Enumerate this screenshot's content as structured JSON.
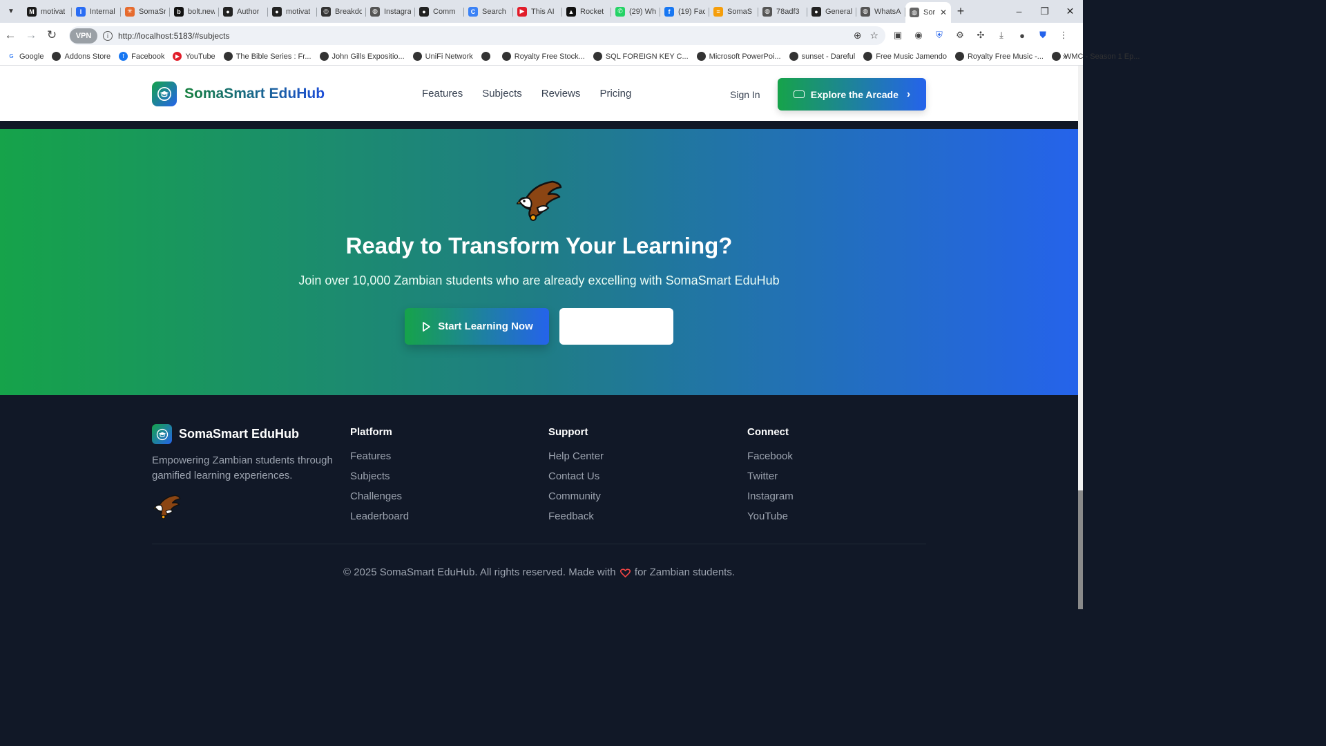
{
  "browser": {
    "tabs": [
      {
        "title": "motivat",
        "color": "#1a1a1a",
        "glyph": "M"
      },
      {
        "title": "Internal",
        "color": "#2a6df4",
        "glyph": "I"
      },
      {
        "title": "SomaSr",
        "color": "#e66b2e",
        "glyph": "✳"
      },
      {
        "title": "bolt.new",
        "color": "#111111",
        "glyph": "b"
      },
      {
        "title": "Author",
        "color": "#222222",
        "glyph": "●"
      },
      {
        "title": "motivat",
        "color": "#222222",
        "glyph": "●"
      },
      {
        "title": "Breakdo",
        "color": "#333333",
        "glyph": "◎"
      },
      {
        "title": "Instagra",
        "color": "#555555",
        "glyph": "◍"
      },
      {
        "title": "Comm",
        "color": "#222222",
        "glyph": "●"
      },
      {
        "title": "Search",
        "color": "#3b82f6",
        "glyph": "C"
      },
      {
        "title": "This AI",
        "color": "#e11d2a",
        "glyph": "▶"
      },
      {
        "title": "Rocket",
        "color": "#111111",
        "glyph": "▲"
      },
      {
        "title": "(29) Wh",
        "color": "#25d366",
        "glyph": "✆"
      },
      {
        "title": "(19) Fac",
        "color": "#1877f2",
        "glyph": "f"
      },
      {
        "title": "SomaS",
        "color": "#f59e0b",
        "glyph": "≡"
      },
      {
        "title": "78adf3",
        "color": "#555555",
        "glyph": "◍"
      },
      {
        "title": "General",
        "color": "#222222",
        "glyph": "●"
      },
      {
        "title": "WhatsA",
        "color": "#555555",
        "glyph": "◍"
      }
    ],
    "active_tab": {
      "title": "Sor",
      "glyph": "◍"
    },
    "new_tab": "+",
    "window_controls": [
      "–",
      "❐",
      "✕"
    ],
    "vpn_label": "VPN",
    "url": "http://localhost:5183/#subjects",
    "bookmarks": [
      {
        "label": "Google",
        "color": "#ffffff",
        "glyph": "G"
      },
      {
        "label": "Addons Store",
        "color": "#333333",
        "glyph": ""
      },
      {
        "label": "Facebook",
        "color": "#1877f2",
        "glyph": "f"
      },
      {
        "label": "YouTube",
        "color": "#e11d2a",
        "glyph": "▶"
      },
      {
        "label": "The Bible Series : Fr...",
        "color": "#333333",
        "glyph": ""
      },
      {
        "label": "John Gills Expositio...",
        "color": "#333333",
        "glyph": ""
      },
      {
        "label": "UniFi Network",
        "color": "#333333",
        "glyph": ""
      },
      {
        "label": "",
        "color": "#333333",
        "glyph": ""
      },
      {
        "label": "Royalty Free Stock...",
        "color": "#333333",
        "glyph": ""
      },
      {
        "label": "SQL FOREIGN KEY C...",
        "color": "#333333",
        "glyph": ""
      },
      {
        "label": "Microsoft PowerPoi...",
        "color": "#333333",
        "glyph": ""
      },
      {
        "label": "sunset - Dareful",
        "color": "#333333",
        "glyph": ""
      },
      {
        "label": "Free Music Jamendo",
        "color": "#333333",
        "glyph": ""
      },
      {
        "label": "Royalty Free Music -...",
        "color": "#333333",
        "glyph": ""
      },
      {
        "label": "WMC - Season 1 Ep...",
        "color": "#333333",
        "glyph": ""
      }
    ],
    "bookmarks_more": "»"
  },
  "site": {
    "brand": "SomaSmart EduHub",
    "nav": [
      "Features",
      "Subjects",
      "Reviews",
      "Pricing"
    ],
    "sign_in": "Sign In",
    "arcade_button": "Explore the Arcade",
    "colors": {
      "green": "#16a34a",
      "blue": "#2563eb",
      "footer_bg": "#111827"
    }
  },
  "cta": {
    "title": "Ready to Transform Your Learning?",
    "subtitle": "Join over 10,000 Zambian students who are already excelling with SomaSmart EduHub",
    "primary_button": "Start Learning Now",
    "secondary_button": ""
  },
  "footer": {
    "brand": "SomaSmart EduHub",
    "description": "Empowering Zambian students through gamified learning experiences.",
    "columns": [
      {
        "heading": "Platform",
        "links": [
          "Features",
          "Subjects",
          "Challenges",
          "Leaderboard"
        ]
      },
      {
        "heading": "Support",
        "links": [
          "Help Center",
          "Contact Us",
          "Community",
          "Feedback"
        ]
      },
      {
        "heading": "Connect",
        "links": [
          "Facebook",
          "Twitter",
          "Instagram",
          "YouTube"
        ]
      }
    ],
    "copyright_before": "© 2025 SomaSmart EduHub. All rights reserved. Made with",
    "copyright_after": "for Zambian students."
  }
}
